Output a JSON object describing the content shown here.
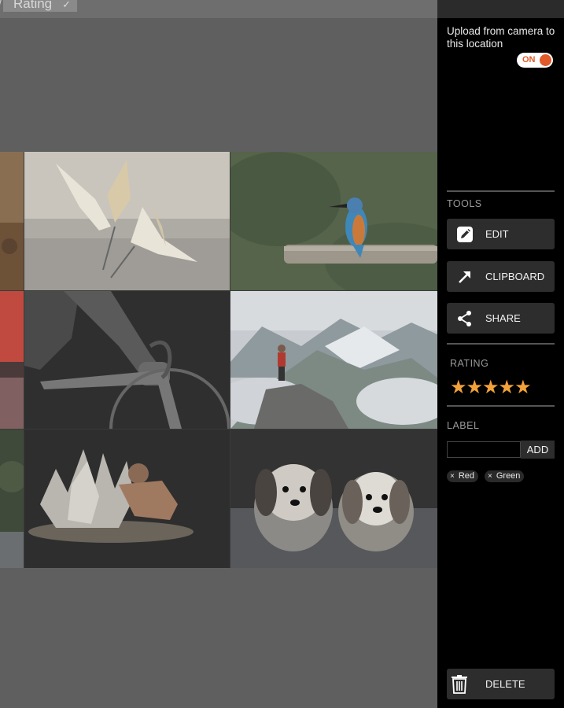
{
  "header": {
    "sort_label": "Rating",
    "sort_chevron": "chevron-down-icon"
  },
  "gallery": {
    "photos": [
      {
        "subject": "fighting-egrets"
      },
      {
        "subject": "kingfisher-on-branch"
      },
      {
        "subject": "cyclist-closeup"
      },
      {
        "subject": "hiker-on-mountain-peak"
      },
      {
        "subject": "dancer-flour-splash"
      },
      {
        "subject": "two-shih-tzu-dogs"
      }
    ]
  },
  "sidebar": {
    "upload_text": "Upload from camera to this location",
    "upload_toggle_label": "ON",
    "upload_toggle_state": true,
    "tools_heading": "TOOLS",
    "tools": [
      {
        "label": "EDIT",
        "icon": "edit-icon"
      },
      {
        "label": "CLIPBOARD",
        "icon": "arrow-up-right-icon"
      },
      {
        "label": "SHARE",
        "icon": "share-icon"
      }
    ],
    "rating_heading": "RATING",
    "rating_value": 5,
    "rating_max": 5,
    "label_heading": "LABEL",
    "label_input_value": "",
    "add_label": "ADD",
    "labels": [
      {
        "remove": "×",
        "text": "Red"
      },
      {
        "remove": "×",
        "text": "Green"
      }
    ],
    "delete_label": "DELETE",
    "delete_icon": "trash-icon"
  },
  "colors": {
    "accent": "#e05a2a",
    "star": "#f2a23a",
    "sidebar_bg": "#000000",
    "button_bg": "#2d2d2d"
  }
}
